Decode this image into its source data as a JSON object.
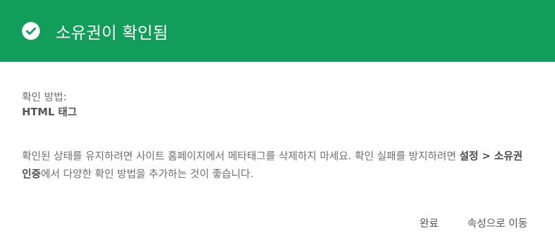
{
  "header": {
    "title": "소유권이 확인됨",
    "icon": "check-circle-icon",
    "background_color": "#129d5a"
  },
  "verification": {
    "method_label": "확인 방법:",
    "method_value": "HTML 태그"
  },
  "description": {
    "part1": "확인된 상태를 유지하려면 사이트 홈페이지에서 메타태그를 삭제하지 마세요. 확인 실패를 방지하려면 ",
    "bold": "설정 > 소유권 인증",
    "part2": "에서 다양한 확인 방법을 추가하는 것이 좋습니다."
  },
  "actions": {
    "done_label": "완료",
    "go_to_property_label": "속성으로 이동"
  }
}
